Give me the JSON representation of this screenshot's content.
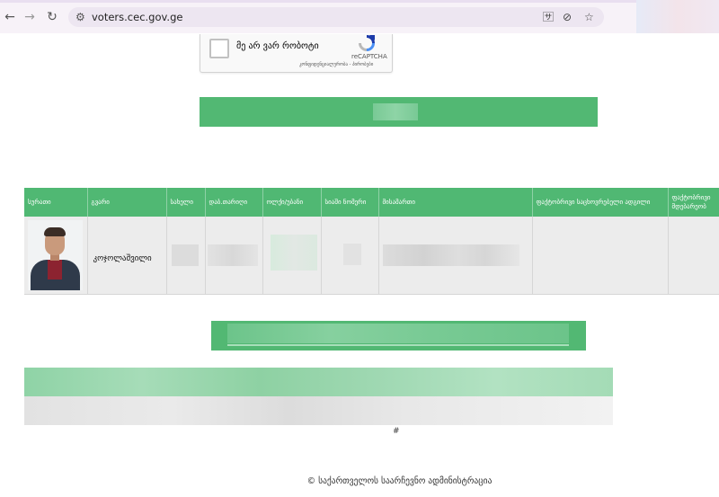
{
  "browser": {
    "url": "voters.cec.gov.ge"
  },
  "captcha": {
    "label": "მე არ ვარ რობოტი",
    "brand": "reCAPTCHA",
    "terms": "კონფიდენციალურობა - პირობები"
  },
  "table": {
    "headers": [
      "სურათი",
      "გვარი",
      "სახელი",
      "დაბ.თარიღი",
      "ოლქი/უბანი",
      "სიაში ნომერი",
      "მისამართი",
      "ფაქტობრივი საცხოვრებელი ადგილი",
      "ფაქტობრივი მდებარეობ"
    ],
    "row": {
      "surname": "კოჯოლაშვილი"
    }
  },
  "hash": "#",
  "footer": "© საქართველოს საარჩევნო ადმინისტრაცია"
}
